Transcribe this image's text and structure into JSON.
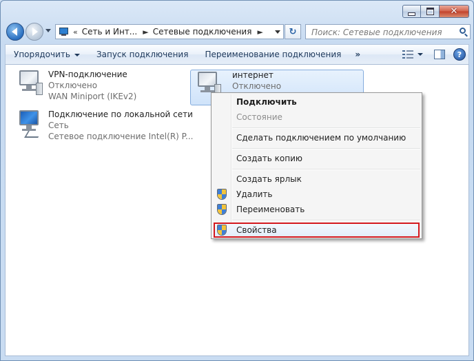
{
  "window": {
    "caption_min": "–",
    "caption_max": "□",
    "caption_close": "✕"
  },
  "navigation": {
    "breadcrumb_overflow": "«",
    "breadcrumbs": [
      "Сеть и Инт...",
      "Сетевые подключения"
    ],
    "breadcrumb_separator": "►",
    "search_placeholder": "Поиск: Сетевые подключения"
  },
  "toolbar": {
    "organize": "Упорядочить",
    "start_connection": "Запуск подключения",
    "rename_connection": "Переименование подключения",
    "more": "»",
    "help": "?"
  },
  "connections": [
    {
      "name": "VPN-подключение",
      "status": "Отключено",
      "device": "WAN Miniport (IKEv2)",
      "icon": "vpn-connection-icon"
    },
    {
      "name": "интернет",
      "status": "Отключено",
      "device": "",
      "icon": "broadband-connection-icon"
    },
    {
      "name": "Подключение по локальной сети",
      "status": "Сеть",
      "device": "Сетевое подключение Intel(R) P...",
      "icon": "lan-connection-icon"
    }
  ],
  "context_menu": {
    "items": [
      {
        "label": "Подключить",
        "bold": true
      },
      {
        "label": "Состояние",
        "disabled": true
      },
      {
        "label": "Сделать подключением по умолчанию"
      },
      {
        "label": "Создать копию"
      },
      {
        "label": "Создать ярлык"
      },
      {
        "label": "Удалить",
        "icon": "uac-shield-icon"
      },
      {
        "label": "Переименовать",
        "icon": "uac-shield-icon"
      },
      {
        "label": "Свойства",
        "icon": "uac-shield-icon",
        "highlighted": true
      }
    ]
  },
  "colors": {
    "highlight_border": "#d4181e",
    "selection_bg": "#cfe3fa",
    "link_text": "#1e395b"
  }
}
